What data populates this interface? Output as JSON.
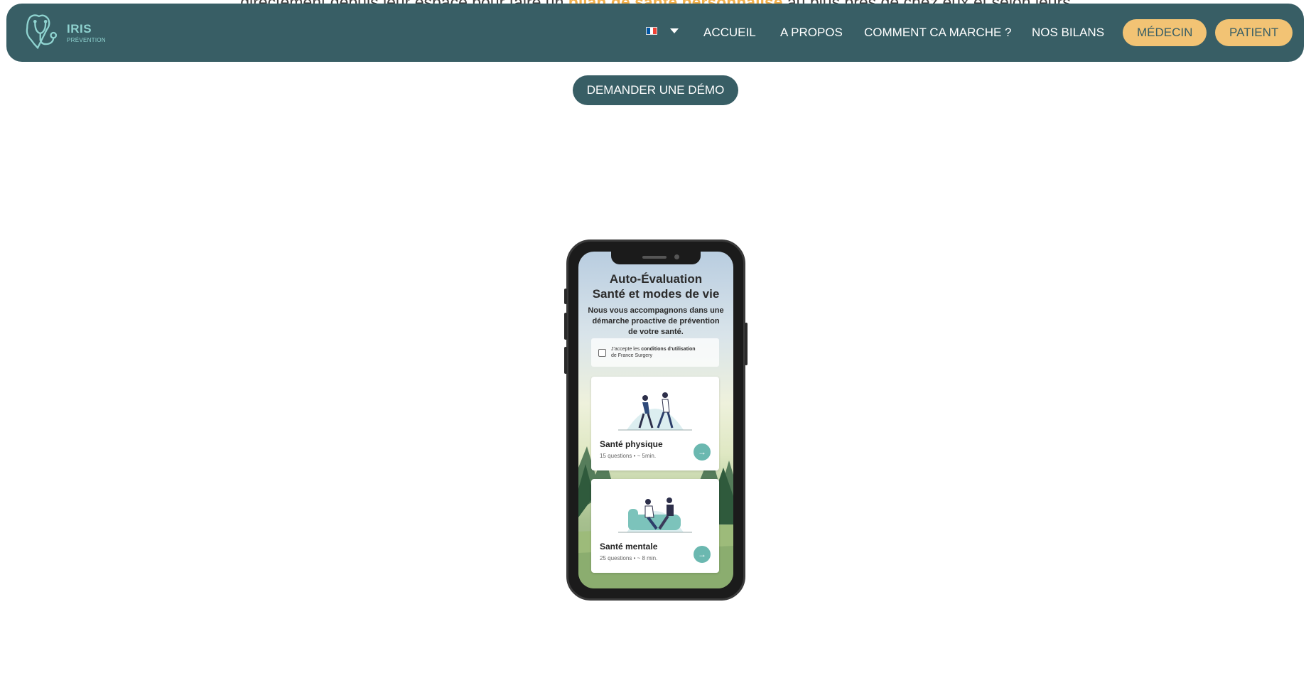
{
  "intro": {
    "before": "directement depuis leur espace pour faire un",
    "highlight": "bilan de santé personnalisé",
    "after": "au plus près de chez eux et selon leurs"
  },
  "logo": {
    "name": "IRIS",
    "sub": "PRÉVENTION"
  },
  "nav": {
    "language": "fr",
    "flag_colors": [
      "#0055a4",
      "#ffffff",
      "#ef4135"
    ],
    "links": [
      "ACCUEIL",
      "A PROPOS",
      "COMMENT CA MARCHE ?",
      "NOS BILANS"
    ],
    "medecin": "MÉDECIN",
    "patient": "PATIENT"
  },
  "demo_button": "DEMANDER UNE DÉMO",
  "phone": {
    "title_line1": "Auto-Évaluation",
    "title_line2": "Santé et modes de vie",
    "subtitle": "Nous vous accompagnons dans une démarche proactive de prévention de votre santé.",
    "accept_prefix": "J'accepte les",
    "accept_bold": "conditions d'utilisation",
    "accept_suffix": "de France Surgery",
    "cards": [
      {
        "title": "Santé physique",
        "meta": "15 questions • ~ 5min."
      },
      {
        "title": "Santé mentale",
        "meta": "25 questions • ~ 8 min."
      }
    ],
    "arrow": "→"
  },
  "colors": {
    "primary": "#385e65",
    "accent": "#f2c374",
    "highlight": "#f2b04b",
    "teal": "#6bb8b0"
  }
}
